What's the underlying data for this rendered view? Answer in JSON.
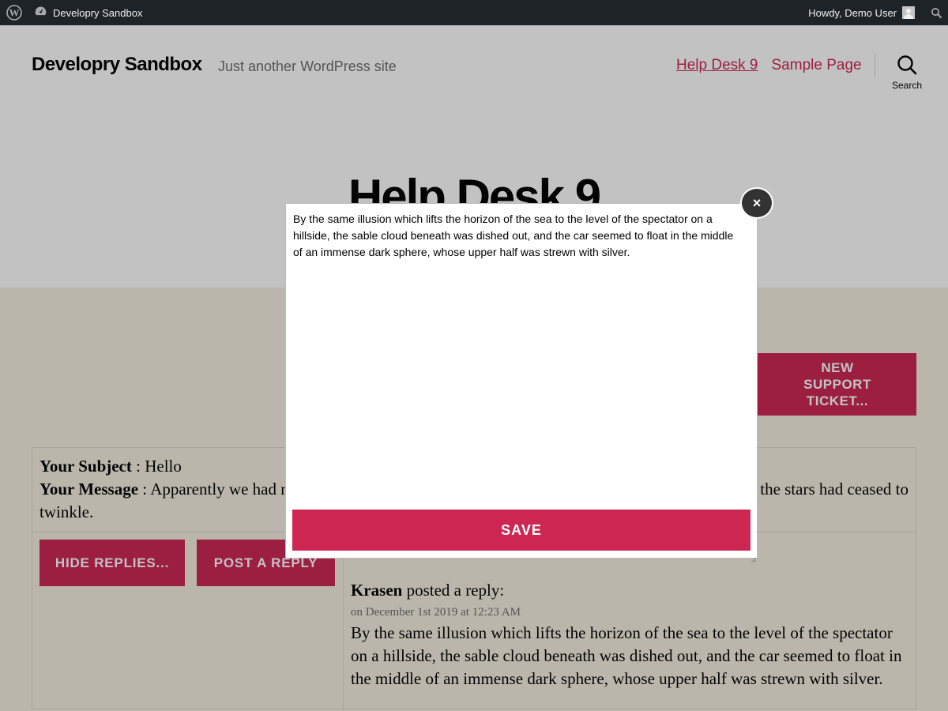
{
  "adminbar": {
    "wp_logo_icon": "wordpress-logo-icon",
    "site_icon": "dashboard-icon",
    "site_name": "Developry Sandbox",
    "howdy": "Howdy, Demo User",
    "search_icon": "search-icon"
  },
  "header": {
    "site_title": "Developry Sandbox",
    "site_description": "Just another WordPress site",
    "menu": [
      {
        "label": "Help Desk 9",
        "current": true
      },
      {
        "label": "Sample Page",
        "current": false
      }
    ],
    "search_label": "Search",
    "accent_color": "#cd2653"
  },
  "page": {
    "title": "Help Desk 9"
  },
  "content": {
    "new_ticket_label": "NEW SUPPORT TICKET...",
    "ticket": {
      "subject_label": "Your Subject",
      "subject_value": ": Hello",
      "message_label": "Your Message",
      "message_value": ": Apparently we had r",
      "message_tail": ". the stars had ceased to",
      "message_wrap": "twinkle."
    },
    "buttons": {
      "hide_replies": "HIDE REPLIES...",
      "post_reply": "POST A REPLY"
    },
    "reply": {
      "author": "Krasen",
      "action": "posted a reply:",
      "date": "on December 1st 2019 at 12:23 AM",
      "text": "By the same illusion which lifts the horizon of the sea to the level of the spectator on a hillside, the sable cloud beneath was dished out, and the car seemed to float in the middle of an immense dark sphere, whose upper half was strewn with silver."
    }
  },
  "modal": {
    "textarea_value": "By the same illusion which lifts the horizon of the sea to the level of the spectator on a hillside, the sable cloud beneath was dished out, and the car seemed to float in the middle of an immense dark sphere, whose upper half was strewn with silver.",
    "save_label": "SAVE",
    "close_label": "×"
  }
}
